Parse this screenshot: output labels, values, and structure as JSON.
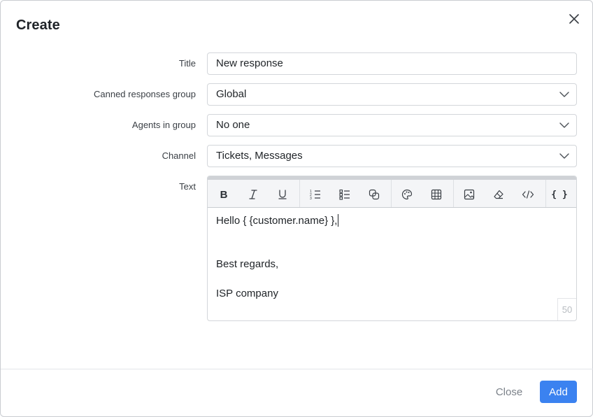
{
  "dialog": {
    "title": "Create",
    "close_icon": "close-icon"
  },
  "form": {
    "title": {
      "label": "Title",
      "value": "New response"
    },
    "group": {
      "label": "Canned responses group",
      "value": "Global"
    },
    "agents": {
      "label": "Agents in group",
      "value": "No one"
    },
    "channel": {
      "label": "Channel",
      "value": "Tickets, Messages"
    },
    "text": {
      "label": "Text",
      "lines": [
        "Hello { {customer.name} },",
        "Best regards,",
        "ISP company"
      ],
      "char_counter": "50"
    }
  },
  "toolbar": {
    "items": [
      "bold-icon",
      "italic-icon",
      "underline-icon",
      "ordered-list-icon",
      "unordered-list-icon",
      "copy-icon",
      "color-palette-icon",
      "table-icon",
      "image-icon",
      "eraser-icon",
      "code-icon",
      "variables-icon"
    ],
    "bold_glyph": "B",
    "variables_glyph": "{ }"
  },
  "footer": {
    "close_label": "Close",
    "add_label": "Add"
  },
  "colors": {
    "primary": "#3b82f0",
    "border": "#d3d6da",
    "toolbar_bg": "#f4f5f7"
  }
}
